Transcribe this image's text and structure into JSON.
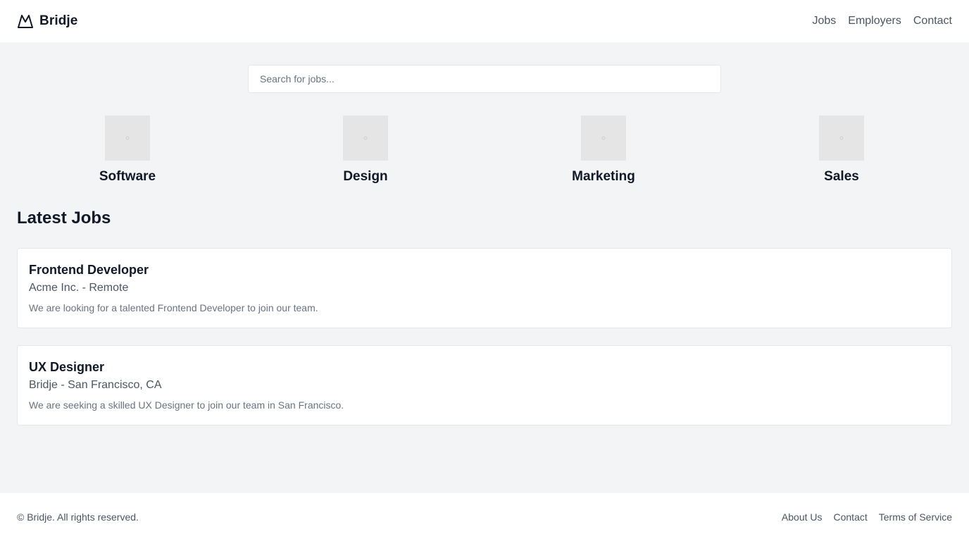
{
  "header": {
    "brand_name": "Bridje",
    "nav": [
      {
        "label": "Jobs"
      },
      {
        "label": "Employers"
      },
      {
        "label": "Contact"
      }
    ]
  },
  "search": {
    "placeholder": "Search for jobs...",
    "value": ""
  },
  "categories": [
    {
      "name": "Software",
      "icon": "image-placeholder-icon"
    },
    {
      "name": "Design",
      "icon": "image-placeholder-icon"
    },
    {
      "name": "Marketing",
      "icon": "image-placeholder-icon"
    },
    {
      "name": "Sales",
      "icon": "image-placeholder-icon"
    }
  ],
  "latest_jobs": {
    "title": "Latest Jobs",
    "items": [
      {
        "title": "Frontend Developer",
        "meta": "Acme Inc. - Remote",
        "description": "We are looking for a talented Frontend Developer to join our team."
      },
      {
        "title": "UX Designer",
        "meta": "Bridje - San Francisco, CA",
        "description": "We are seeking a skilled UX Designer to join our team in San Francisco."
      }
    ]
  },
  "footer": {
    "copyright": "© Bridje. All rights reserved.",
    "links": [
      {
        "label": "About Us"
      },
      {
        "label": "Contact"
      },
      {
        "label": "Terms of Service"
      }
    ]
  },
  "colors": {
    "page_background": "#f3f4f6",
    "surface": "#ffffff",
    "text_primary": "#111827",
    "text_secondary": "#4b5563",
    "text_muted": "#6b7280",
    "border": "#e5e7eb",
    "placeholder_image": "#e5e5e5"
  }
}
